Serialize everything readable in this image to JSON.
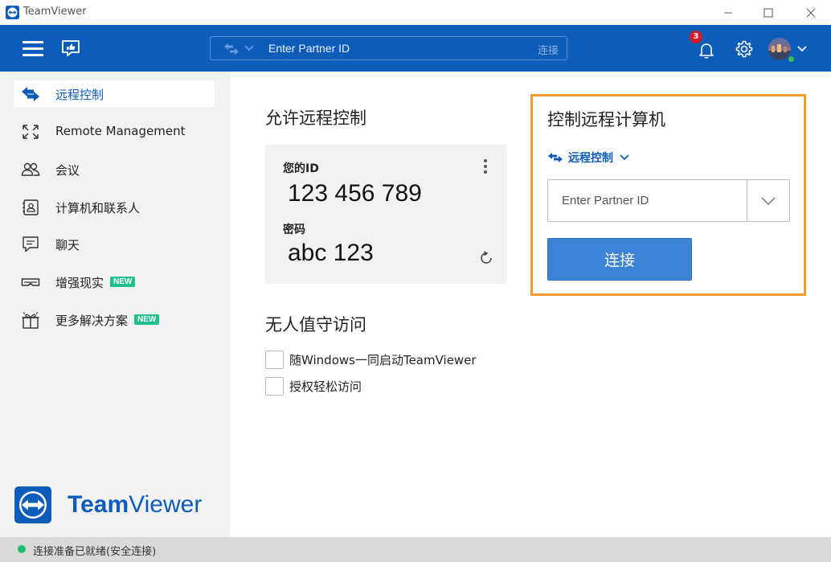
{
  "window": {
    "title": "TeamViewer",
    "controls": {
      "minimize": "minimize",
      "maximize": "maximize",
      "close": "close"
    }
  },
  "toolbar": {
    "partner_placeholder": "Enter Partner ID",
    "connect_label": "连接",
    "notification_count": "3"
  },
  "sidebar": {
    "items": [
      {
        "label": "远程控制",
        "icon": "arrows-swap-icon",
        "active": true,
        "badge": ""
      },
      {
        "label": "Remote Management",
        "icon": "expand-arrows-icon",
        "active": false,
        "badge": ""
      },
      {
        "label": "会议",
        "icon": "people-icon",
        "active": false,
        "badge": ""
      },
      {
        "label": "计算机和联系人",
        "icon": "contact-card-icon",
        "active": false,
        "badge": ""
      },
      {
        "label": "聊天",
        "icon": "chat-icon",
        "active": false,
        "badge": ""
      },
      {
        "label": "增强现实",
        "icon": "ar-glasses-icon",
        "active": false,
        "badge": "NEW"
      },
      {
        "label": "更多解决方案",
        "icon": "gift-icon",
        "active": false,
        "badge": "NEW"
      }
    ],
    "brand": {
      "bold": "Team",
      "light": "Viewer"
    }
  },
  "allow": {
    "heading": "允许远程控制",
    "id_label": "您的ID",
    "id_value": "123 456 789",
    "password_label": "密码",
    "password_value": "abc 123"
  },
  "unattended": {
    "heading": "无人值守访问",
    "options": [
      {
        "label": "随Windows一同启动TeamViewer",
        "checked": false
      },
      {
        "label": "授权轻松访问",
        "checked": false
      }
    ]
  },
  "control": {
    "heading": "控制远程计算机",
    "mode_label": "远程控制",
    "partner_placeholder": "Enter Partner ID",
    "connect_label": "连接"
  },
  "status": {
    "text": "连接准备已就绪(安全连接)"
  },
  "colors": {
    "brand_blue": "#0e5cba",
    "button_blue": "#3d84d6",
    "highlight_orange": "#f79a2f",
    "status_green": "#1fbf6a",
    "new_badge": "#1fbf8f"
  }
}
